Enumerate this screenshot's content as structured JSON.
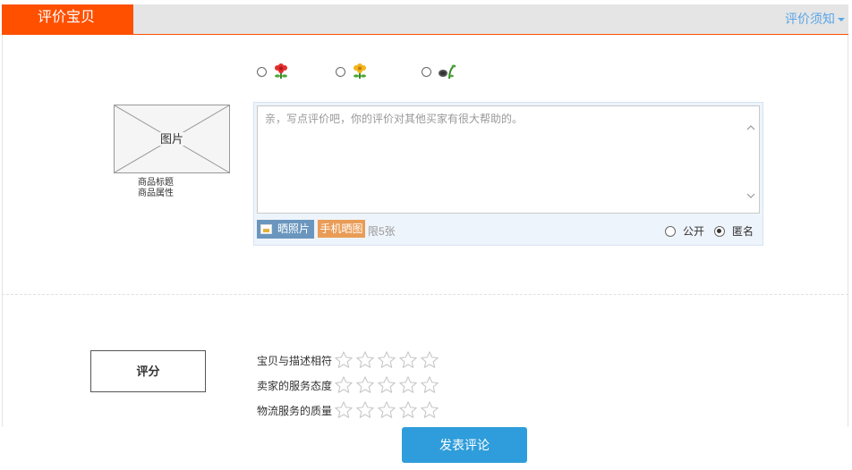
{
  "header": {
    "tab_label": "评价宝贝",
    "notice_label": "评价须知"
  },
  "satisfaction": {
    "options": [
      {
        "icon": "red-flower-icon (good)",
        "selected": false
      },
      {
        "icon": "yellow-flower-icon (neutral)",
        "selected": false
      },
      {
        "icon": "wilted-flower-icon (bad)",
        "selected": false
      }
    ]
  },
  "product": {
    "image_label": "图片",
    "title": "商品标题",
    "attribute": "商品属性"
  },
  "review": {
    "placeholder": "亲，写点评价吧，你的评价对其他买家有很大帮助的。",
    "photo_button": "晒照片",
    "mobile_button": "手机晒图",
    "limit_text": "限5张",
    "visibility": {
      "public_label": "公开",
      "anonymous_label": "匿名",
      "selected": "anonymous"
    }
  },
  "scoring": {
    "box_label": "评分",
    "rows": [
      {
        "label": "宝贝与描述相符",
        "stars": 5,
        "filled": 0
      },
      {
        "label": "卖家的服务态度",
        "stars": 5,
        "filled": 0
      },
      {
        "label": "物流服务的质量",
        "stars": 5,
        "filled": 0
      }
    ]
  },
  "submit_label": "发表评论",
  "colors": {
    "accent": "#ff5000",
    "link": "#5aa6e6",
    "submit": "#2f9ddb"
  }
}
